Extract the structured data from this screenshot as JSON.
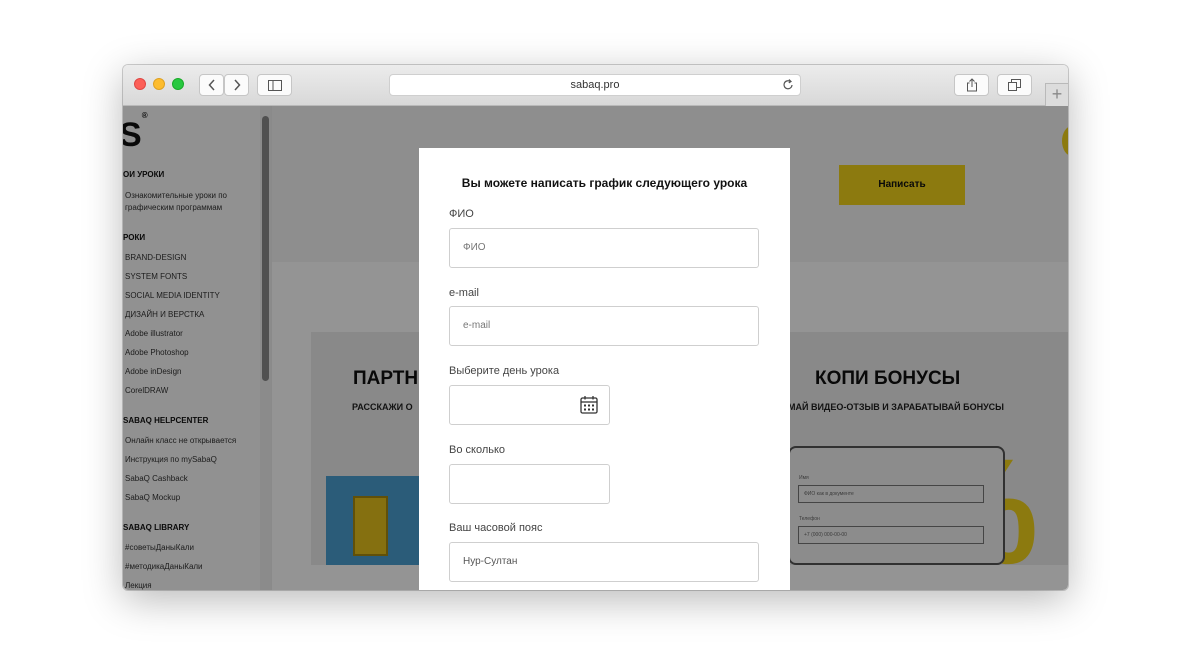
{
  "browser": {
    "url": "sabaq.pro"
  },
  "sidebar": {
    "logo": "S",
    "logo_mark": "®",
    "sections": [
      {
        "heading": "ОИ УРОКИ",
        "items": [
          "Ознакомительные уроки по",
          "графическим программам"
        ]
      },
      {
        "heading": "РОКИ",
        "items": [
          "BRAND-DESIGN",
          "SYSTEM FONTS",
          "SOCIAL MEDIA IDENTITY",
          "ДИЗАЙН И ВЕРСТКА",
          "Adobe illustrator",
          "Adobe Photoshop",
          "Adobe inDesign",
          "CorelDRAW"
        ]
      },
      {
        "heading": "SABAQ HELPCENTER",
        "items": [
          "Онлайн класс не открывается",
          "Инструкция по mySabaQ",
          "SabaQ Cashback",
          "SabaQ Mockup"
        ]
      },
      {
        "heading": "SABAQ LIBRARY",
        "items": [
          "#советыДаныКали",
          "#методикаДаныКали",
          "Лекция"
        ]
      }
    ]
  },
  "hero": {
    "write_button": "Написать"
  },
  "banner": {
    "left_title": "ПАРТН",
    "left_subtitle": "РАССКАЖИ О",
    "right_title": "КОПИ БОНУСЫ",
    "right_subtitle": "МАЙ ВИДЕО-ОТЗЫВ И ЗАРАБАТЫВАЙ БОНУСЫ",
    "mock_label_1": "Имя",
    "mock_field_1": "ФИО как в документе",
    "mock_label_2": "Телефон",
    "mock_field_2": "+7 (000) 000-00-00",
    "percent": "%"
  },
  "modal": {
    "title": "Вы можете написать график следующего урока",
    "fields": {
      "name_label": "ФИО",
      "name_placeholder": "ФИО",
      "email_label": "e-mail",
      "email_placeholder": "e-mail",
      "day_label": "Выберите день урока",
      "time_label": "Во сколько",
      "timezone_label": "Ваш часовой пояс",
      "timezone_value": "Нур-Султан"
    }
  },
  "colors": {
    "accent": "#f2d21b",
    "overlay": "rgba(0,0,0,0.42)"
  },
  "icons": [
    "back-icon",
    "forward-icon",
    "sidebar-icon",
    "reload-icon",
    "share-icon",
    "tabs-icon",
    "calendar-icon",
    "plus-icon"
  ]
}
